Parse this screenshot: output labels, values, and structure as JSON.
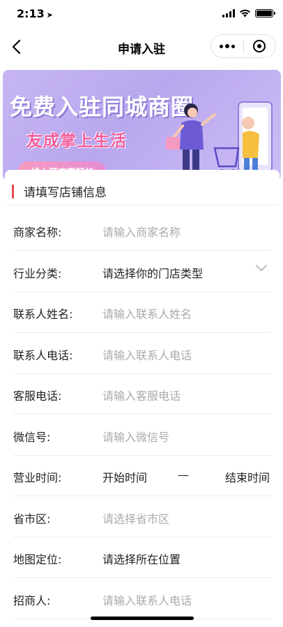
{
  "status_bar": {
    "time": "2:13"
  },
  "nav": {
    "title": "申请入驻"
  },
  "banner": {
    "title": "免费入驻同城商圈",
    "subtitle": "友成掌上生活",
    "chip": "线上开店更轻松"
  },
  "form": {
    "section_title": "请填写店铺信息",
    "rows": [
      {
        "label": "商家名称:",
        "placeholder": "请输入商家名称"
      },
      {
        "label": "行业分类:",
        "value": "请选择你的门店类型"
      },
      {
        "label": "联系人姓名:",
        "placeholder": "请输入联系人姓名"
      },
      {
        "label": "联系人电话:",
        "placeholder": "请输入联系人电话"
      },
      {
        "label": "客服电话:",
        "placeholder": "请输入客服电话"
      },
      {
        "label": "微信号:",
        "placeholder": "请输入微信号"
      },
      {
        "label": "营业时间:",
        "start": "开始时间",
        "dash": "—",
        "end": "结束时间"
      },
      {
        "label": "省市区:",
        "placeholder": "请选择省市区"
      },
      {
        "label": "地图定位:",
        "value": "请选择所在位置"
      },
      {
        "label": "招商人:",
        "placeholder": "请输入联系人电话"
      }
    ]
  },
  "colors": {
    "accent_red": "#e5484d",
    "banner_purple": "#c7b6f2",
    "banner_pink": "#f25c9b"
  }
}
